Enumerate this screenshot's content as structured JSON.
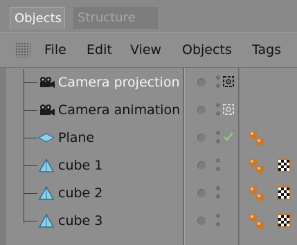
{
  "tabs": [
    {
      "label": "Objects",
      "active": true
    },
    {
      "label": "Structure",
      "active": false
    }
  ],
  "menu": [
    "File",
    "Edit",
    "View",
    "Objects",
    "Tags"
  ],
  "objects": [
    {
      "name": "Camera projection",
      "icon": "camera-icon",
      "selected": true,
      "tag": "target-icon",
      "material": false,
      "checker": false
    },
    {
      "name": "Camera animation",
      "icon": "camera-icon",
      "selected": false,
      "tag": "target-icon",
      "material": false,
      "checker": false
    },
    {
      "name": "Plane",
      "icon": "plane-icon",
      "selected": false,
      "tag": "checkmark-icon",
      "material": true,
      "checker": false
    },
    {
      "name": "cube 1",
      "icon": "cube-icon",
      "selected": false,
      "tag": null,
      "material": true,
      "checker": true
    },
    {
      "name": "cube 2",
      "icon": "cube-icon",
      "selected": false,
      "tag": null,
      "material": true,
      "checker": true
    },
    {
      "name": "cube 3",
      "icon": "cube-icon",
      "selected": false,
      "tag": null,
      "material": true,
      "checker": true
    }
  ],
  "colors": {
    "panel": "#8e8e8e",
    "selected_text": "#f4f4f4",
    "check_green": "#8fc97e",
    "material_orange": "#c57a2f"
  }
}
